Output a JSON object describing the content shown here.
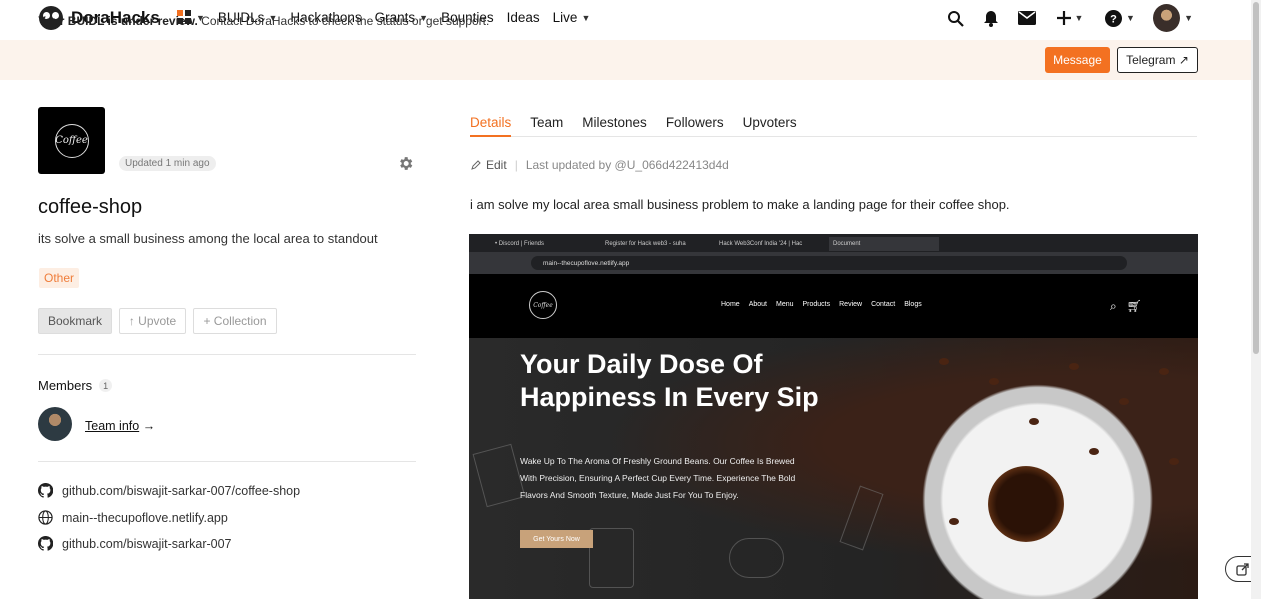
{
  "nav": {
    "brand": "DoraHacks",
    "links": [
      {
        "label": "BUIDLs",
        "has_menu": true
      },
      {
        "label": "Hackathons",
        "has_menu": false
      },
      {
        "label": "Grants",
        "has_menu": true
      },
      {
        "label": "Bounties",
        "has_menu": false
      },
      {
        "label": "Ideas",
        "has_menu": false
      },
      {
        "label": "Live",
        "has_menu": true
      }
    ],
    "icons": [
      "apps-grid-icon",
      "search-icon",
      "bell-icon",
      "mail-icon",
      "plus-icon",
      "help-icon",
      "user-avatar"
    ]
  },
  "banner": {
    "bold": "Your BUIDL is under review.",
    "text": " Contact DoraHacks to check the status or get support.",
    "message_label": "Message",
    "telegram_label": "Telegram ↗",
    "accent": "#f37121"
  },
  "project": {
    "updated": "Updated 1 min ago",
    "name": "coffee-shop",
    "description": "its solve a small business among the local area to standout",
    "tag": "Other",
    "bookmark": "Bookmark",
    "upvote": "↑ Upvote",
    "collection": "+ Collection",
    "members_label": "Members",
    "members_count": "1",
    "team_info": "Team info",
    "team_arrow": "→",
    "links": [
      {
        "icon": "github-icon",
        "text": "github.com/biswajit-sarkar-007/coffee-shop"
      },
      {
        "icon": "globe-icon",
        "text": "main--thecupoflove.netlify.app"
      },
      {
        "icon": "github-icon",
        "text": "github.com/biswajit-sarkar-007"
      }
    ]
  },
  "tabs": [
    "Details",
    "Team",
    "Milestones",
    "Followers",
    "Upvoters"
  ],
  "details": {
    "edit": "Edit",
    "last_updated": "Last updated by @U_066d422413d4d",
    "text": "i am solve my local area small business problem to make a landing page for their coffee shop."
  },
  "screenshot": {
    "browser_tabs": [
      "• Discord | Friends",
      "Register for Hack web3 - suha",
      "Hack Web3Conf India '24 | Hac",
      "Document"
    ],
    "url": "main--thecupoflove.netlify.app",
    "site_logo": "Coffee",
    "menu": [
      "Home",
      "About",
      "Menu",
      "Products",
      "Review",
      "Contact",
      "Blogs"
    ],
    "hero_title": "Your Daily Dose Of Happiness In Every Sip",
    "hero_sub": "Wake Up To The Aroma Of Freshly Ground Beans. Our Coffee Is Brewed With Precision, Ensuring A Perfect Cup Every Time. Experience The Bold Flavors And Smooth Texture, Made Just For You To Enjoy.",
    "hero_button": "Get Yours Now"
  }
}
